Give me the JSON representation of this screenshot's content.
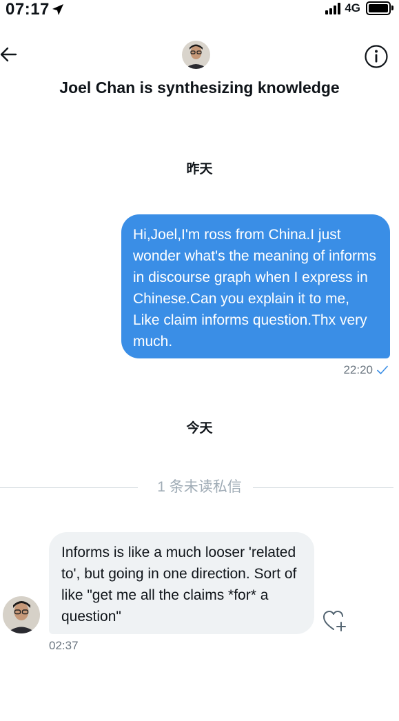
{
  "status": {
    "time": "07:17",
    "network": "4G"
  },
  "header": {
    "title": "Joel Chan is synthesizing knowledge",
    "back_icon": "arrow-left-icon",
    "info_icon": "info-circle-icon"
  },
  "conversation": {
    "day1_label": "昨天",
    "outgoing": {
      "text": "Hi,Joel,I'm ross from China.I just wonder what's the meaning of informs in discourse graph when I express in Chinese.Can you explain it to me, Like claim informs question.Thx very much.",
      "time": "22:20",
      "read_icon": "checkmark-icon"
    },
    "day2_label": "今天",
    "unread_label": "1 条未读私信",
    "incoming": {
      "text": "Informs is like a much looser 'related to', but going in one direction. Sort of like \"get me all the claims *for* a question\"",
      "time": "02:37",
      "react_icon": "heart-add-icon"
    }
  },
  "colors": {
    "outgoing_bubble": "#3a8ee6",
    "incoming_bubble": "#eff2f4",
    "muted_text": "#6b7680"
  }
}
